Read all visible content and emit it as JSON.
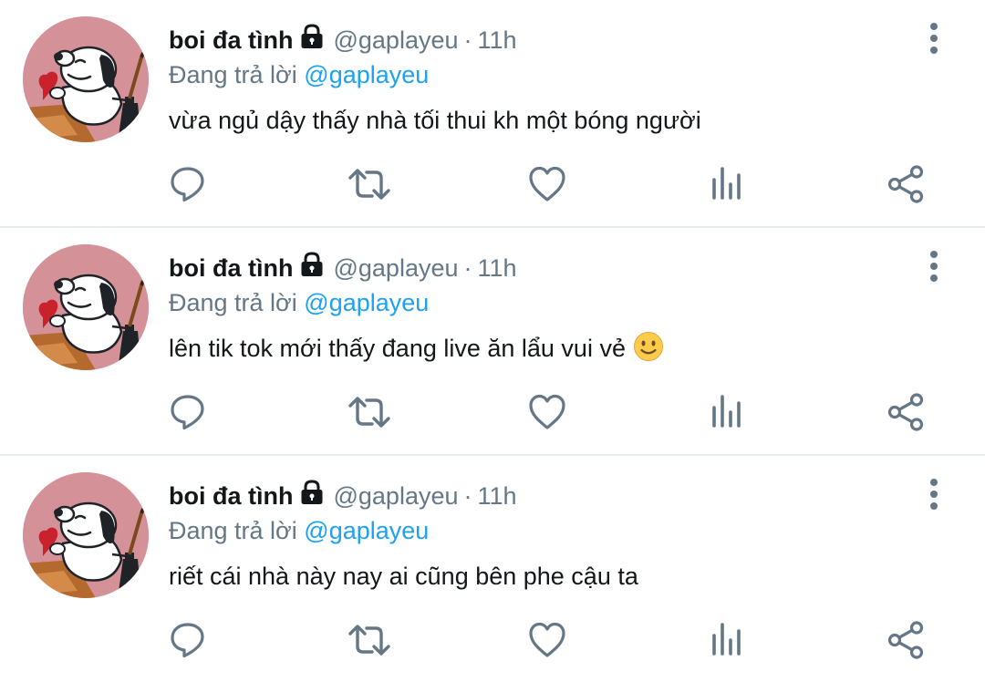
{
  "colors": {
    "name": "#14171a",
    "secondary": "#657786",
    "mention": "#1da1f2",
    "icon": "#657786",
    "divider": "#e8ecee",
    "avatar_bg": "#d49198"
  },
  "tweets": [
    {
      "name": "boi đa tình",
      "handle": "@gaplayeu",
      "dot": "·",
      "time": "11h",
      "reply_prefix": "Đang trả lời",
      "reply_to": "@gaplayeu",
      "text": "vừa ngủ dậy thấy nhà tối thui kh một bóng người",
      "emoji": ""
    },
    {
      "name": "boi đa tình",
      "handle": "@gaplayeu",
      "dot": "·",
      "time": "11h",
      "reply_prefix": "Đang trả lời",
      "reply_to": "@gaplayeu",
      "text": "lên tik tok mới thấy đang live ăn lẩu vui vẻ",
      "emoji": "slightly-smiling-face-emoji"
    },
    {
      "name": "boi đa tình",
      "handle": "@gaplayeu",
      "dot": "·",
      "time": "11h",
      "reply_prefix": "Đang trả lời",
      "reply_to": "@gaplayeu",
      "text": "riết cái nhà này nay ai cũng bên phe cậu ta",
      "emoji": ""
    }
  ],
  "icons": {
    "avatar": "snoopy-avatar",
    "verified": "lock-icon",
    "more": "more-options-icon",
    "actions": [
      "reply-icon",
      "retweet-icon",
      "like-icon",
      "analytics-icon",
      "share-icon"
    ]
  }
}
